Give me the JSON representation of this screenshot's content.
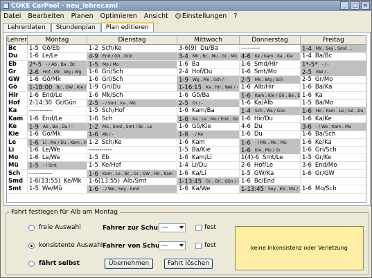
{
  "window": {
    "title": "COKE CarPool  -  neu_lehrer.xml"
  },
  "menu": [
    "Datei",
    "Bearbeiten",
    "Planen",
    "Optimieren",
    "Ansicht",
    "Einstellungen",
    "?"
  ],
  "tabs": [
    {
      "label": "Lehrerdaten",
      "active": false
    },
    {
      "label": "Stundenplan",
      "active": false
    },
    {
      "label": "Plan editieren",
      "active": true
    }
  ],
  "table": {
    "columns": [
      "Lehrer",
      "Montag",
      "Dienstag",
      "Mittwoch",
      "Donnerstag",
      "Freitag"
    ],
    "rows": [
      [
        "Bc",
        [
          "1-5",
          "Gö/Eb",
          ""
        ],
        [
          "1-2",
          "Sch/Ke",
          ""
        ],
        [
          "3-6(9)",
          "Du/Ba",
          ""
        ],
        [
          "---------",
          "",
          ""
        ],
        [
          "1-4",
          "Mk , Sey , Smd ...",
          "g"
        ]
      ],
      [
        "Du",
        [
          "1-6",
          "Le/Le",
          ""
        ],
        [
          "4-9",
          "End / Gö , Gün",
          "g"
        ],
        [
          "3-4",
          "Mk , Bc , Mu , Gr , Mü",
          "g"
        ],
        [
          "4-6",
          "Ke / Kam , Ka , Kie",
          "g"
        ],
        [
          "1-4",
          "Ba/Bc",
          ""
        ]
      ],
      [
        "Eb",
        [
          "2*-5",
          "- / Ab , Ba , Bc",
          "g"
        ],
        [
          "1-5",
          "Mo / Mo",
          "g"
        ],
        [
          "1-6",
          "Ba",
          ""
        ],
        [
          "1-6",
          "Smd/Hir",
          ""
        ],
        [
          "1*-5*",
          "- / -",
          "g"
        ]
      ],
      [
        "Gr",
        [
          "2-6",
          "Hof , Mk , Wg / Wg",
          "g"
        ],
        [
          "1-6",
          "Gri/Sch",
          ""
        ],
        [
          "2-4",
          "Hof/Du",
          ""
        ],
        [
          "1-6",
          "Smt/Mo",
          ""
        ],
        [
          "2-5",
          "GW / -",
          "g"
        ]
      ],
      [
        "GW",
        [
          "1-6",
          "Gö/Mk",
          ""
        ],
        [
          "1-6",
          "Gri/Sch",
          ""
        ],
        [
          "1-9",
          "Wg , Me , Sch / -",
          "g"
        ],
        [
          "2-5",
          "Mk , Wg / Sch",
          "g"
        ],
        [
          "2-5",
          "Gr/Mo",
          ""
        ]
      ],
      [
        "Gö",
        [
          "1-1B:00",
          "Bc , GW , Kie / -",
          "g"
        ],
        [
          "1-9",
          "Gri/Du",
          ""
        ],
        [
          "1-16:15",
          "Ka , Hir , Wei / -",
          "g"
        ],
        [
          "1-6",
          "Alb/Hir",
          ""
        ],
        [
          "1-6",
          "Ba/Ka",
          ""
        ]
      ],
      [
        "Hir",
        [
          "1-6",
          "End/Le",
          ""
        ],
        [
          "1-6",
          "Mk/Sch",
          ""
        ],
        [
          "1-6",
          "Gö/Ba",
          ""
        ],
        [
          "1-6",
          "Kam , Kie / Gö , Ba , Eb",
          "g"
        ],
        [
          "1-6",
          "Ka",
          ""
        ]
      ],
      [
        "Hof",
        [
          "2-14:30",
          "Gr/Gün",
          ""
        ],
        [
          "2-5",
          "- / Smt , Ka , Mü",
          "g"
        ],
        [
          "2-5",
          "Gr / -",
          "g"
        ],
        [
          "1-6",
          "Ka/Alb",
          ""
        ],
        [
          "1-5",
          "Ba/Mo",
          ""
        ]
      ],
      [
        "Ka",
        [
          "-----------",
          "",
          ""
        ],
        [
          "1-5",
          "Sch/Hof",
          ""
        ],
        [
          "1-6",
          "Kam/Ba",
          ""
        ],
        [
          "1-4",
          "Sch , We / Gün",
          "g"
        ],
        [
          "1-6",
          "Hir , Kam , Le / Gö , Du",
          "g"
        ]
      ],
      [
        "Kam",
        [
          "1-6",
          "End/Le",
          ""
        ],
        [
          "1-6",
          "Sch",
          ""
        ],
        [
          "1-6",
          "Ka , Le , Mo / End , Gri , Le",
          "g"
        ],
        [
          "1-6",
          "Hir/Du",
          ""
        ],
        [
          "1-6",
          "Ka/Ke",
          ""
        ]
      ],
      [
        "Ke",
        [
          "1-9",
          "Ab , Ba , Du / -",
          "g"
        ],
        [
          "1-2",
          "Mü , Smd , Smt / Bc , Le",
          "g"
        ],
        [
          "1-6",
          "Gö/Kie",
          ""
        ],
        [
          "4-6",
          "Du",
          ""
        ],
        [
          "3-6",
          "- / We , Kam , Mo",
          "g"
        ]
      ],
      [
        "Kie",
        [
          "1-6",
          "Gö/Mk",
          ""
        ],
        [
          "1-6",
          "Ab / -",
          "g"
        ],
        [
          "1-6",
          "- / Ke",
          "g"
        ],
        [
          "1-6",
          "Du",
          ""
        ],
        [
          "1-6",
          "Ba/Sch",
          ""
        ]
      ],
      [
        "Le",
        [
          "1-6",
          "Li , Mo / Du , Kam , Hir",
          "g"
        ],
        [
          "1-2",
          "Sch/Ke",
          ""
        ],
        [
          "1-6",
          "Kam",
          ""
        ],
        [
          "1-6",
          "- / Mk , Mo , Mü",
          "g"
        ],
        [
          "1-6",
          "Ke/Ka",
          ""
        ]
      ],
      [
        "Li",
        [
          "1-6",
          "Le/We",
          ""
        ],
        [
          "-----------",
          "",
          ""
        ],
        [
          "1-5",
          "Ba/Kie",
          ""
        ],
        [
          "1-6",
          "Kie , Mo / Gr",
          "g"
        ],
        [
          "1-6",
          "Gri/Sch",
          ""
        ]
      ],
      [
        "Mo",
        [
          "1-6",
          "Le/We",
          ""
        ],
        [
          "1-5",
          "Eb",
          ""
        ],
        [
          "1-6",
          "Kam/Li",
          ""
        ],
        [
          "1(4)-6",
          "Smt/Le",
          ""
        ],
        [
          "1-5",
          "Gr/Ke",
          ""
        ]
      ],
      [
        "Mü",
        [
          "1-5",
          "- / Smt",
          "g"
        ],
        [
          "1-5",
          "Ke/Hof",
          ""
        ],
        [
          "1-4",
          "Li/Du",
          ""
        ],
        [
          "2-6",
          "Hof/Le",
          ""
        ],
        [
          "3-6",
          "End/Mo",
          ""
        ]
      ],
      [
        "Sch",
        [
          "-----------",
          "",
          ""
        ],
        [
          "1-6",
          "Kam , Le , Bc , Gr , GW , Hir , Kam",
          "g"
        ],
        [
          "1-6",
          "Ka/Li",
          ""
        ],
        [
          "1-5",
          "GW/Ka",
          ""
        ],
        [
          "1-6",
          "Gr/GW",
          ""
        ]
      ],
      [
        "Smd",
        [
          "1-6(13:55)",
          "Ke/Mk",
          ""
        ],
        [
          "1-6(13:55)",
          "Alb/Smt",
          ""
        ],
        [
          "1-13:45",
          "Gr , Gri , Gün / -",
          "g"
        ],
        [
          "1-6",
          "Bc/End",
          ""
        ],
        [
          "",
          "",
          ""
        ]
      ],
      [
        "Smt",
        [
          "1-5",
          "We/Mü",
          ""
        ],
        [
          "1-6",
          "- / We , Sey , Smd",
          "g"
        ],
        [
          "1-6",
          "Ka/We",
          ""
        ],
        [
          "1-13:45",
          "Sey , Eb , Mü / -",
          "g"
        ],
        [
          "1-6",
          "Mo/Sch",
          ""
        ]
      ]
    ]
  },
  "group": {
    "label": "Fahrt festlegen für Alb am Montag",
    "radios": [
      {
        "label": "freie Auswahl",
        "checked": false
      },
      {
        "label": "konsistente Auswahl",
        "checked": true
      },
      {
        "label": "fährt selbst",
        "checked": false
      }
    ],
    "to_school_label": "Fahrer zur Schule:",
    "from_school_label": "Fahrer von Schule:",
    "to_school_value": "---",
    "from_school_value": "---",
    "fest_label": "fest",
    "apply_label": "Übernehmen",
    "delete_label": "Fahrt löschen",
    "info_text": "keine Inkonsistenz oder Verletzung"
  }
}
